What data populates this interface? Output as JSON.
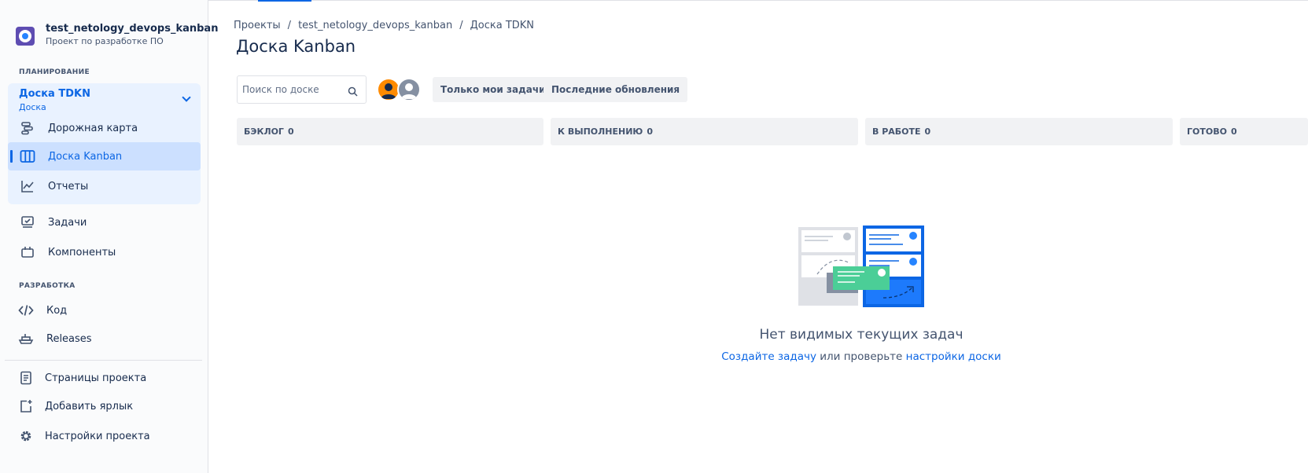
{
  "project": {
    "name": "test_netology_devops_kanban",
    "type": "Проект по разработке ПО"
  },
  "sidebar": {
    "planning_label": "ПЛАНИРОВАНИЕ",
    "board_group": {
      "title": "Доска TDKN",
      "subtitle": "Доска"
    },
    "planning_items": [
      {
        "label": "Дорожная карта",
        "icon": "roadmap-icon"
      },
      {
        "label": "Доска Kanban",
        "icon": "board-icon"
      },
      {
        "label": "Отчеты",
        "icon": "reports-icon"
      }
    ],
    "other_items": [
      {
        "label": "Задачи",
        "icon": "issues-icon"
      },
      {
        "label": "Компоненты",
        "icon": "components-icon"
      }
    ],
    "dev_label": "РАЗРАБОТКА",
    "dev_items": [
      {
        "label": "Код",
        "icon": "code-icon"
      },
      {
        "label": "Releases",
        "icon": "releases-icon"
      }
    ],
    "bottom_items": [
      {
        "label": "Страницы проекта",
        "icon": "pages-icon"
      },
      {
        "label": "Добавить ярлык",
        "icon": "add-shortcut-icon"
      },
      {
        "label": "Настройки проекта",
        "icon": "settings-icon"
      }
    ]
  },
  "breadcrumb": [
    "Проекты",
    "test_netology_devops_kanban",
    "Доска TDKN"
  ],
  "page": {
    "title": "Доска Kanban"
  },
  "search": {
    "placeholder": "Поиск по доске"
  },
  "filters": {
    "my_issues": "Только мои задачи",
    "recent_updates": "Последние обновления"
  },
  "columns": [
    {
      "name": "БЭКЛОГ",
      "count": "0"
    },
    {
      "name": "К ВЫПОЛНЕНИЮ",
      "count": "0"
    },
    {
      "name": "В РАБОТЕ",
      "count": "0"
    },
    {
      "name": "ГОТОВО",
      "count": "0"
    }
  ],
  "empty_state": {
    "title": "Нет видимых текущих задач",
    "create_link": "Создайте задачу",
    "middle_text": " или проверьте ",
    "settings_link": "настройки доски"
  },
  "colors": {
    "accent": "#0c66e4",
    "active_bg": "#cce0ff",
    "group_bg": "#e9f2ff"
  }
}
